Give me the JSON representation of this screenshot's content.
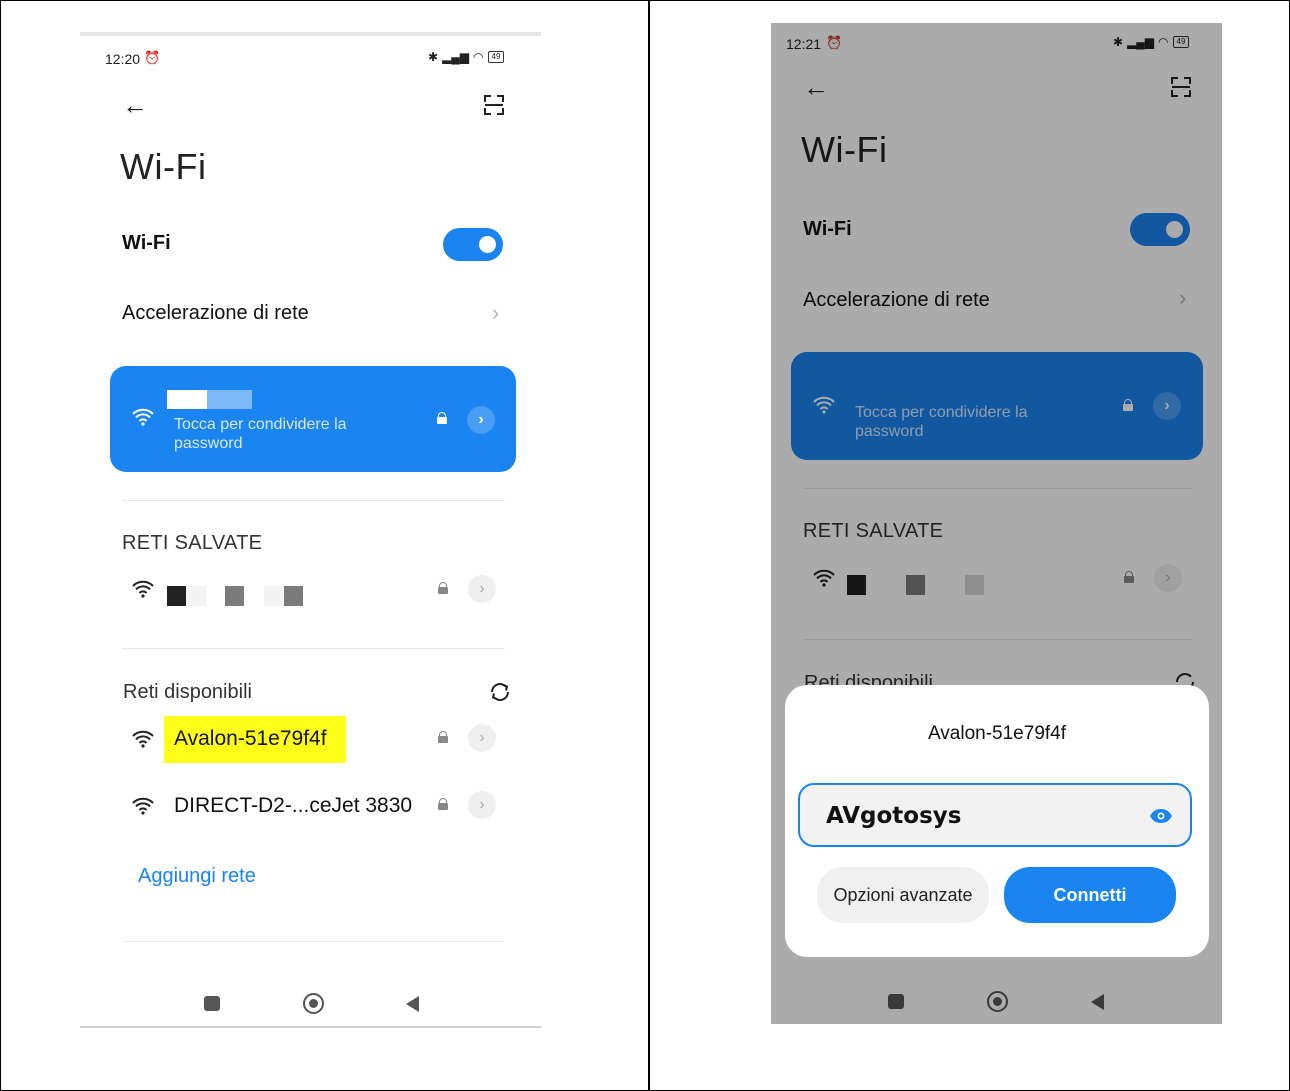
{
  "left": {
    "status": {
      "time": "12:20",
      "battery": "49"
    },
    "title": "Wi-Fi",
    "wifi_row": {
      "label": "Wi-Fi",
      "enabled": true
    },
    "acceleration_row": {
      "label": "Accelerazione di rete"
    },
    "connected_card": {
      "subtitle_line1": "Tocca per condividere la",
      "subtitle_line2": "password"
    },
    "saved_header": "RETI SALVATE",
    "available_header": "Reti disponibili",
    "available_networks": [
      {
        "name": "Avalon-51e79f4f",
        "highlighted": true
      },
      {
        "name": "DIRECT-D2-...ceJet 3830",
        "highlighted": false
      }
    ],
    "add_network": "Aggiungi rete"
  },
  "right": {
    "status": {
      "time": "12:21",
      "battery": "49"
    },
    "title": "Wi-Fi",
    "wifi_row": {
      "label": "Wi-Fi",
      "enabled": true
    },
    "acceleration_row": {
      "label": "Accelerazione di rete"
    },
    "connected_card": {
      "subtitle_line1": "Tocca per condividere la",
      "subtitle_line2": "password"
    },
    "saved_header": "RETI SALVATE",
    "available_header": "Reti disponibili",
    "dialog": {
      "network_name": "Avalon-51e79f4f",
      "password": "AVgotosys",
      "advanced_button": "Opzioni avanzate",
      "connect_button": "Connetti"
    }
  },
  "colors": {
    "accent": "#1a84f0",
    "highlight": "#ffff1a"
  }
}
